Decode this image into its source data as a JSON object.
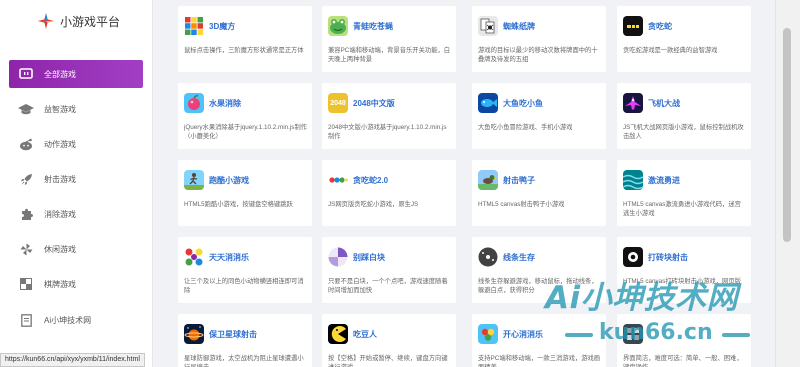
{
  "app": {
    "title": "小游戏平台",
    "accent": "#9b2fbf",
    "link_color": "#2f6fd1"
  },
  "sidebar": {
    "items": [
      {
        "label": "全部游戏",
        "icon": "tv-icon",
        "active": true
      },
      {
        "label": "益智游戏",
        "icon": "graduation-cap-icon"
      },
      {
        "label": "动作游戏",
        "icon": "reddit-icon"
      },
      {
        "label": "射击游戏",
        "icon": "rocket-icon"
      },
      {
        "label": "消除游戏",
        "icon": "puzzle-icon"
      },
      {
        "label": "休闲游戏",
        "icon": "pinwheel-icon"
      },
      {
        "label": "棋牌游戏",
        "icon": "chessboard-icon"
      },
      {
        "label": "Ai小坤技术网",
        "icon": "page-icon"
      }
    ]
  },
  "games": [
    {
      "title": "3D魔方",
      "desc": "鼠标点击操作，三阶魔方形状通常是正方体",
      "icon": "rubik-cube-icon"
    },
    {
      "title": "青蛙吃苍蝇",
      "desc": "兼容PC端和移动端，背景音乐开关功能，白天晚上两种背景",
      "icon": "frog-icon"
    },
    {
      "title": "蜘蛛纸牌",
      "desc": "游戏的目标以最少的移动次数将牌面中的十叠牌及待发的五组",
      "icon": "spider-icon"
    },
    {
      "title": "贪吃蛇",
      "desc": "贪吃蛇游戏是一款经典的益智游戏",
      "icon": "snake-icon"
    },
    {
      "title": "水果消除",
      "desc": "jQuery水果消除基于jquery.1.10.2.min.js制作（小蘑美化）",
      "icon": "fruit-icon"
    },
    {
      "title": "2048中文版",
      "desc": "2048中文版小游戏基于jquery.1.10.2.min.js制作",
      "icon": "2048-icon",
      "icon_text": "2048"
    },
    {
      "title": "大鱼吃小鱼",
      "desc": "大鱼吃小鱼冒险游戏、手机小游戏",
      "icon": "fish-icon"
    },
    {
      "title": "飞机大战",
      "desc": "JS飞机大战网页版小游戏，鼠标控制战机攻击敌人",
      "icon": "plane-icon"
    },
    {
      "title": "跑酷小游戏",
      "desc": "HTML5跑酷小游戏，按键盘空格键跳跃",
      "icon": "runner-icon"
    },
    {
      "title": "贪吃蛇2.0",
      "desc": "JS网页版贪吃蛇小游戏，原生JS",
      "icon": "snake2-icon"
    },
    {
      "title": "射击鸭子",
      "desc": "HTML5 canvas射击鸭子小游戏",
      "icon": "duck-icon"
    },
    {
      "title": "激流勇进",
      "desc": "HTML5 canvas激流勇进小游戏代码，迷宫逃生小游戏",
      "icon": "rapids-icon"
    },
    {
      "title": "天天消消乐",
      "desc": "让三个及以上的同色小动物横竖相连即可消除",
      "icon": "match3-icon"
    },
    {
      "title": "别踩白块",
      "desc": "只要不是白块，一个个点吧，游戏速度随着时间增加而加快",
      "icon": "piano-tiles-icon"
    },
    {
      "title": "线条生存",
      "desc": "线条生存躲避游戏，移动鼠标，拖动线条，躲避白点，获得积分",
      "icon": "line-survive-icon"
    },
    {
      "title": "打砖块射击",
      "desc": "HTML5 canvas打砖块射击小游戏，网页版",
      "icon": "brick-icon"
    },
    {
      "title": "保卫星球射击",
      "desc": "星球防御游戏，太空战机为阻止星球遭遇小行星撞击",
      "icon": "planet-icon"
    },
    {
      "title": "吃豆人",
      "desc": "按【空格】开始或暂停、继续，键盘方向键进行游戏",
      "icon": "pacman-icon"
    },
    {
      "title": "开心消消乐",
      "desc": "支持PC端和移动端，一款三消游戏，游戏画面精美",
      "icon": "happy-match-icon"
    },
    {
      "title": "",
      "desc": "界面简洁，难度可选：简单、一般、困难，键盘操作",
      "icon": "game-icon"
    }
  ],
  "statusbar": {
    "url": "https://kun66.cn/api/xyx/yxmb/11/index.html"
  },
  "watermark": {
    "line1": "Ai小坤技术网",
    "line2": "kun66.cn"
  }
}
